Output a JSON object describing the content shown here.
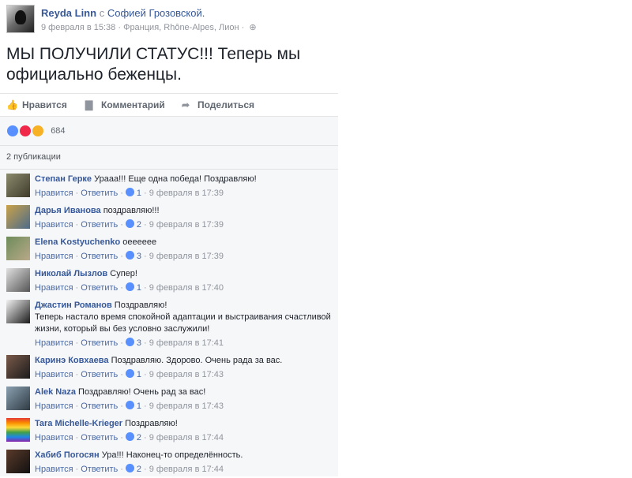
{
  "post": {
    "author": "Reyda Linn",
    "with_prefix": "с",
    "with_person": "Софией Грозовской.",
    "timestamp": "9 февраля в 15:38",
    "location": "Франция, Rhône-Alpes, Лион",
    "dot": "·",
    "globe": "⊕",
    "text": "МЫ ПОЛУЧИЛИ СТАТУС!!! Теперь мы официально беженцы."
  },
  "actions": {
    "like": "Нравится",
    "comment": "Комментарий",
    "share": "Поделиться",
    "like_icon": "👍",
    "comment_icon": "▇",
    "share_icon": "➦"
  },
  "reactions": {
    "count": "684"
  },
  "shares": {
    "label": "2 публикации"
  },
  "comment_labels": {
    "like": "Нравится",
    "reply": "Ответить",
    "dot": "·"
  },
  "comments": [
    {
      "name": "Степан Герке",
      "text": "Урааа!!! Еще одна победа! Поздравляю!",
      "likes": "1",
      "time": "9 февраля в 17:39"
    },
    {
      "name": "Дарья Иванова",
      "text": "поздравляю!!!",
      "likes": "2",
      "time": "9 февраля в 17:39"
    },
    {
      "name": "Elena Kostyuchenko",
      "text": "оееееее",
      "likes": "3",
      "time": "9 февраля в 17:39"
    },
    {
      "name": "Николай Лызлов",
      "text": "Супер!",
      "likes": "1",
      "time": "9 февраля в 17:40"
    },
    {
      "name": "Джастин Романов",
      "text": "Поздравляю!",
      "text2": "Теперь настало время спокойной адаптации и выстраивания счастливой жизни, который вы без условно заслужили!",
      "likes": "3",
      "time": "9 февраля в 17:41"
    },
    {
      "name": "Каринэ Ковхаева",
      "text": "Поздравляю. Здорово. Очень рада за вас.",
      "likes": "1",
      "time": "9 февраля в 17:43"
    },
    {
      "name": "Alek Naza",
      "text": "Поздравляю! Очень рад за вас!",
      "likes": "1",
      "time": "9 февраля в 17:43"
    },
    {
      "name": "Tara Michelle-Krieger",
      "text": "Поздравляю!",
      "likes": "2",
      "time": "9 февраля в 17:44"
    },
    {
      "name": "Хабиб Погосян",
      "text": "Ура!!! Наконец-то определённость.",
      "likes": "2",
      "time": "9 февраля в 17:44"
    }
  ],
  "colors": {
    "link": "#365899",
    "meta": "#90949c",
    "feedback_bg": "#f6f7f9",
    "like_blue": "#5890ff"
  }
}
